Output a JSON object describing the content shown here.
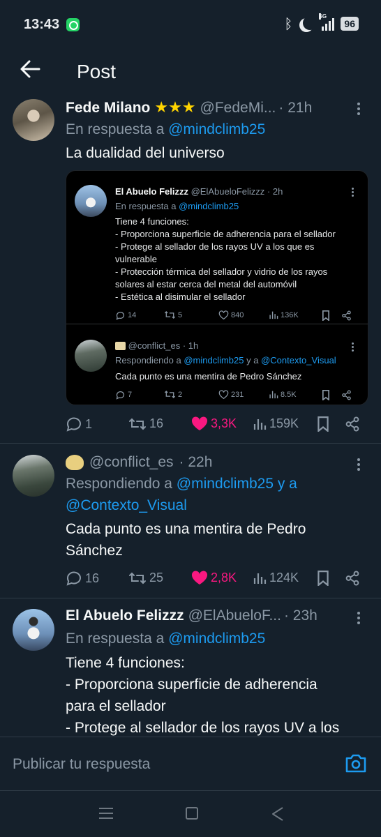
{
  "status_bar": {
    "time": "13:43",
    "network": "5G",
    "battery": "96"
  },
  "header": {
    "title": "Post"
  },
  "tweets": [
    {
      "name": "Fede Milano",
      "badge": "★★★",
      "handle": "@FedeMi...",
      "time": "· 21h",
      "reply_prefix": "En respuesta a ",
      "reply_to": "@mindclimb25",
      "body": "La dualidad del universo",
      "stats": {
        "replies": "1",
        "retweets": "16",
        "likes": "3,3K",
        "views": "159K"
      },
      "embed": {
        "first": {
          "name": "El Abuelo Felizzz",
          "handle": "@ElAbueloFelizzz · 2h",
          "reply_prefix": "En respuesta a ",
          "reply_to": "@mindclimb25",
          "body": "Tiene 4 funciones:\n- Proporciona superficie de adherencia para el sellador\n- Protege al sellador de los rayos UV a los que es vulnerable\n- Protección térmica del sellador y vidrio de los rayos solares al estar cerca del metal del automóvil\n- Estética al disimular el sellador",
          "stats": {
            "replies": "14",
            "retweets": "5",
            "likes": "840",
            "views": "136K"
          }
        },
        "second": {
          "handle": "@conflict_es · 1h",
          "reply_prefix": "Respondiendo a ",
          "reply_to": "@mindclimb25",
          "reply_and": " y a ",
          "reply_to_2": "@Contexto_Visual",
          "body": "Cada punto es una mentira de Pedro Sánchez",
          "stats": {
            "replies": "7",
            "retweets": "2",
            "likes": "231",
            "views": "8.5K"
          }
        }
      }
    },
    {
      "handle": "@conflict_es",
      "time": "· 22h",
      "reply_prefix": "Respondiendo a ",
      "reply_to": "@mindclimb25",
      "reply_and": " y a",
      "reply_to_2": "@Contexto_Visual",
      "body": "Cada punto es una mentira de Pedro\nSánchez",
      "stats": {
        "replies": "16",
        "retweets": "25",
        "likes": "2,8K",
        "views": "124K"
      }
    },
    {
      "name": "El Abuelo Felizzz",
      "handle": "@ElAbueloF...",
      "time": "· 23h",
      "reply_prefix": "En respuesta a ",
      "reply_to": "@mindclimb25",
      "body": "Tiene 4 funciones:\n- Proporciona superficie de adherencia\npara el sellador\n- Protege al sellador de los rayos UV a los"
    }
  ],
  "composer": {
    "placeholder": "Publicar tu respuesta"
  },
  "colors": {
    "background": "#15202b",
    "link": "#1d9bf0",
    "like": "#f91880",
    "muted": "#8b98a5"
  },
  "icons": [
    "whatsapp-icon",
    "bluetooth-icon",
    "moon-icon",
    "signal-icon",
    "back-arrow-icon",
    "more-icon",
    "reply-icon",
    "retweet-icon",
    "heart-icon",
    "views-icon",
    "bookmark-icon",
    "share-icon",
    "camera-icon",
    "nav-menu-icon",
    "nav-home-icon",
    "nav-back-icon"
  ]
}
